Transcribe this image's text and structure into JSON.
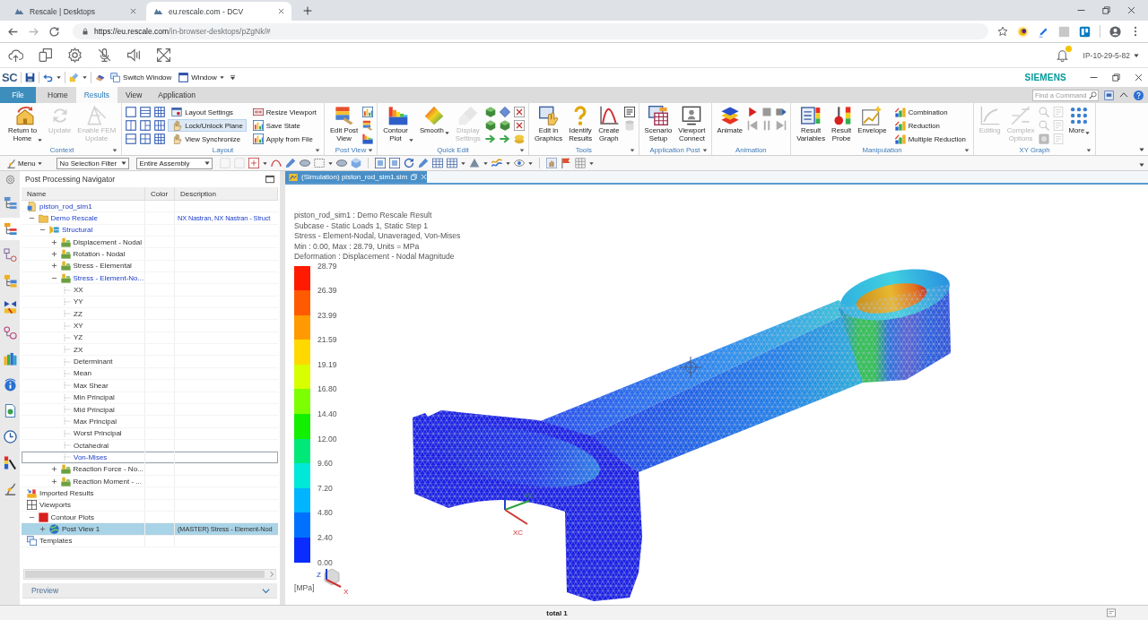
{
  "browser": {
    "tabs": [
      {
        "title": "Rescale | Desktops",
        "selected": false
      },
      {
        "title": "eu.rescale.com - DCV",
        "selected": true
      }
    ],
    "address": {
      "host": "https://eu.rescale.com",
      "path": "/in-browser-desktops/pZgNk/#"
    }
  },
  "dcv_toolbar": {
    "host": "IP-10-29-5-82"
  },
  "app": {
    "logo": "SC",
    "commands": [
      {
        "label": "Switch Window",
        "dropdown": false
      },
      {
        "label": "Window",
        "dropdown": true
      }
    ],
    "brand": "SIEMENS"
  },
  "ribbon": {
    "tabs": [
      {
        "label": "File",
        "kind": "file",
        "selected": false
      },
      {
        "label": "Home",
        "kind": "tab",
        "selected": false
      },
      {
        "label": "Results",
        "kind": "tab",
        "selected": true
      },
      {
        "label": "View",
        "kind": "tab",
        "selected": false
      },
      {
        "label": "Application",
        "kind": "tab",
        "selected": false
      }
    ],
    "search": {
      "placeholder": "Find a Command"
    },
    "groups": [
      {
        "title": "Context",
        "launcher": true,
        "items": [
          {
            "kind": "large",
            "label": "Return to\nHome",
            "dropdown": true,
            "disabled": false
          },
          {
            "kind": "large",
            "label": "Update",
            "dropdown": false,
            "disabled": true
          },
          {
            "kind": "large",
            "label": "Enable FEM\nUpdate",
            "dropdown": false,
            "disabled": true
          }
        ]
      },
      {
        "title": "Layout",
        "launcher": true,
        "items": [
          {
            "kind": "icons",
            "disabled": false
          },
          {
            "kind": "stack",
            "entries": [
              {
                "label": "Layout Settings",
                "on": false
              },
              {
                "label": "Lock/Unlock Plane",
                "on": true
              },
              {
                "label": "View Synchronize",
                "on": false
              }
            ]
          },
          {
            "kind": "stack",
            "entries": [
              {
                "label": "Resize Viewport",
                "on": false
              },
              {
                "label": "Save State",
                "on": false
              },
              {
                "label": "Apply from File",
                "on": false
              }
            ]
          }
        ]
      },
      {
        "title": "Post View",
        "launcher": true,
        "items": [
          {
            "kind": "large",
            "label": "Edit Post\nView",
            "dropdown": false,
            "disabled": false
          },
          {
            "kind": "icons",
            "disabled": false
          }
        ]
      },
      {
        "title": "Quick Edit",
        "launcher": true,
        "items": [
          {
            "kind": "large",
            "label": "Contour\nPlot",
            "dropdown": true,
            "disabled": false
          },
          {
            "kind": "large",
            "label": "Smooth",
            "dropdown": true,
            "disabled": false
          },
          {
            "kind": "large",
            "label": "Display\nSettings",
            "dropdown": false,
            "disabled": true
          },
          {
            "kind": "icons",
            "disabled": false
          }
        ]
      },
      {
        "title": "Tools",
        "launcher": true,
        "items": [
          {
            "kind": "large",
            "label": "Edit in\nGraphics",
            "dropdown": false,
            "disabled": false
          },
          {
            "kind": "large",
            "label": "Identify\nResults",
            "dropdown": false,
            "disabled": false
          },
          {
            "kind": "large",
            "label": "Create\nGraph",
            "dropdown": false,
            "disabled": false
          },
          {
            "kind": "icons",
            "disabled": false
          }
        ]
      },
      {
        "title": "Application Post",
        "launcher": true,
        "items": [
          {
            "kind": "large",
            "label": "Scenario\nSetup",
            "dropdown": false,
            "disabled": false
          },
          {
            "kind": "large",
            "label": "Viewport\nConnect",
            "dropdown": false,
            "disabled": false
          }
        ]
      },
      {
        "title": "Animation",
        "launcher": false,
        "items": [
          {
            "kind": "large",
            "label": "Animate",
            "dropdown": false,
            "disabled": false
          },
          {
            "kind": "icons",
            "disabled": false
          }
        ]
      },
      {
        "title": "Manipulation",
        "launcher": true,
        "items": [
          {
            "kind": "large",
            "label": "Result\nVariables",
            "dropdown": false,
            "disabled": false
          },
          {
            "kind": "large",
            "label": "Result\nProbe",
            "dropdown": false,
            "disabled": false
          },
          {
            "kind": "large",
            "label": "Envelope",
            "dropdown": false,
            "disabled": false
          },
          {
            "kind": "stack",
            "entries": [
              {
                "label": "Combination",
                "on": false
              },
              {
                "label": "Reduction",
                "on": false
              },
              {
                "label": "Multiple Reduction",
                "on": false
              }
            ]
          }
        ]
      },
      {
        "title": "XY Graph",
        "launcher": true,
        "items": [
          {
            "kind": "large",
            "label": "Editing",
            "dropdown": false,
            "disabled": true
          },
          {
            "kind": "large",
            "label": "Complex\nOptions",
            "dropdown": false,
            "disabled": true
          },
          {
            "kind": "icons",
            "disabled": true
          },
          {
            "kind": "large",
            "label": "More",
            "dropdown": true,
            "disabled": false
          }
        ]
      }
    ]
  },
  "toolbar": {
    "menu": "Menu",
    "filters": [
      "No Selection Filter",
      "Entire Assembly"
    ]
  },
  "resource_bar": [
    {
      "selected": false
    },
    {
      "selected": true
    },
    {
      "selected": false
    },
    {
      "selected": false
    },
    {
      "selected": false
    },
    {
      "selected": false
    },
    {
      "selected": false
    },
    {
      "selected": false
    },
    {
      "selected": false
    },
    {
      "selected": false
    },
    {
      "selected": false
    },
    {
      "selected": false
    }
  ],
  "navigator": {
    "title": "Post Processing Navigator",
    "columns": [
      "Name",
      "Color",
      "Description"
    ],
    "tree": [
      {
        "name": "piston_rod_sim1",
        "kind": "sim",
        "active": true,
        "selected": false,
        "focused": false,
        "children": [
          {
            "name": "Demo Rescale",
            "kind": "folder",
            "active": true,
            "selected": false,
            "focused": false,
            "expanded": true,
            "description": "NX Nastran, NX Nastran - Struct",
            "children": [
              {
                "name": "Structural",
                "kind": "solution",
                "active": true,
                "selected": false,
                "focused": false,
                "expanded": true,
                "children": [
                  {
                    "name": "Displacement - Nodal",
                    "kind": "result",
                    "active": false,
                    "selected": false,
                    "focused": false,
                    "expanded": false
                  },
                  {
                    "name": "Rotation - Nodal",
                    "kind": "result",
                    "active": false,
                    "selected": false,
                    "focused": false,
                    "expanded": false
                  },
                  {
                    "name": "Stress - Elemental",
                    "kind": "result",
                    "active": false,
                    "selected": false,
                    "focused": false,
                    "expanded": false
                  },
                  {
                    "name": "Stress - Element-No...",
                    "kind": "result",
                    "active": true,
                    "selected": false,
                    "focused": false,
                    "expanded": true,
                    "children": [
                      {
                        "name": "XX",
                        "kind": "component",
                        "active": false,
                        "selected": false,
                        "focused": false
                      },
                      {
                        "name": "YY",
                        "kind": "component",
                        "active": false,
                        "selected": false,
                        "focused": false
                      },
                      {
                        "name": "ZZ",
                        "kind": "component",
                        "active": false,
                        "selected": false,
                        "focused": false
                      },
                      {
                        "name": "XY",
                        "kind": "component",
                        "active": false,
                        "selected": false,
                        "focused": false
                      },
                      {
                        "name": "YZ",
                        "kind": "component",
                        "active": false,
                        "selected": false,
                        "focused": false
                      },
                      {
                        "name": "ZX",
                        "kind": "component",
                        "active": false,
                        "selected": false,
                        "focused": false
                      },
                      {
                        "name": "Determinant",
                        "kind": "component",
                        "active": false,
                        "selected": false,
                        "focused": false
                      },
                      {
                        "name": "Mean",
                        "kind": "component",
                        "active": false,
                        "selected": false,
                        "focused": false
                      },
                      {
                        "name": "Max Shear",
                        "kind": "component",
                        "active": false,
                        "selected": false,
                        "focused": false
                      },
                      {
                        "name": "Min Principal",
                        "kind": "component",
                        "active": false,
                        "selected": false,
                        "focused": false
                      },
                      {
                        "name": "Mid Principal",
                        "kind": "component",
                        "active": false,
                        "selected": false,
                        "focused": false
                      },
                      {
                        "name": "Max Principal",
                        "kind": "component",
                        "active": false,
                        "selected": false,
                        "focused": false
                      },
                      {
                        "name": "Worst Principal",
                        "kind": "component",
                        "active": false,
                        "selected": false,
                        "focused": false
                      },
                      {
                        "name": "Octahedral",
                        "kind": "component",
                        "active": false,
                        "selected": false,
                        "focused": false
                      },
                      {
                        "name": "Von-Mises",
                        "kind": "component",
                        "active": true,
                        "selected": false,
                        "focused": true
                      }
                    ]
                  },
                  {
                    "name": "Reaction Force - No...",
                    "kind": "result",
                    "active": false,
                    "selected": false,
                    "focused": false,
                    "expanded": false
                  },
                  {
                    "name": "Reaction Moment - ...",
                    "kind": "result",
                    "active": false,
                    "selected": false,
                    "focused": false,
                    "expanded": false
                  }
                ]
              }
            ]
          }
        ]
      },
      {
        "name": "Imported Results",
        "kind": "imported",
        "active": false,
        "selected": false,
        "focused": false
      },
      {
        "name": "Viewports",
        "kind": "viewports",
        "active": false,
        "selected": false,
        "focused": false,
        "children": [
          {
            "name": "Contour Plots",
            "kind": "group",
            "active": false,
            "selected": false,
            "focused": false,
            "expanded": true,
            "children": [
              {
                "name": "Post View 1",
                "kind": "post-view",
                "active": false,
                "selected": true,
                "focused": false,
                "expanded": false,
                "description": "(MASTER) Stress - Element-Nod"
              }
            ]
          }
        ]
      },
      {
        "name": "Templates",
        "kind": "templates",
        "active": false,
        "selected": false,
        "focused": false
      }
    ],
    "preview": "Preview"
  },
  "viewport": {
    "tab": "(Simulation) piston_rod_sim1.sim",
    "info": [
      "piston_rod_sim1 : Demo Rescale Result",
      "Subcase - Static Loads 1, Static Step 1",
      "Stress - Element-Nodal, Unaveraged, Von-Mises",
      "Min : 0.00, Max : 28.79, Units = MPa",
      "Deformation : Displacement - Nodal Magnitude"
    ],
    "legend": {
      "labels": [
        "28.79",
        "26.39",
        "23.99",
        "21.59",
        "19.19",
        "16.80",
        "14.40",
        "12.00",
        "9.60",
        "7.20",
        "4.80",
        "2.40",
        "0.00"
      ],
      "bands": [
        {
          "color": "#ff1a00"
        },
        {
          "color": "#ff5a00"
        },
        {
          "color": "#ff9a00"
        },
        {
          "color": "#ffd800"
        },
        {
          "color": "#d8ff00"
        },
        {
          "color": "#7cff00"
        },
        {
          "color": "#12f000"
        },
        {
          "color": "#00e878"
        },
        {
          "color": "#00e8d8"
        },
        {
          "color": "#00b4ff"
        },
        {
          "color": "#0070ff"
        },
        {
          "color": "#0a2cff"
        }
      ],
      "unit": "[MPa]"
    },
    "triad": [
      "XC",
      "YC"
    ],
    "mini_triad": [
      "Z",
      "X"
    ]
  },
  "status_bar": {
    "text": "total 1"
  }
}
